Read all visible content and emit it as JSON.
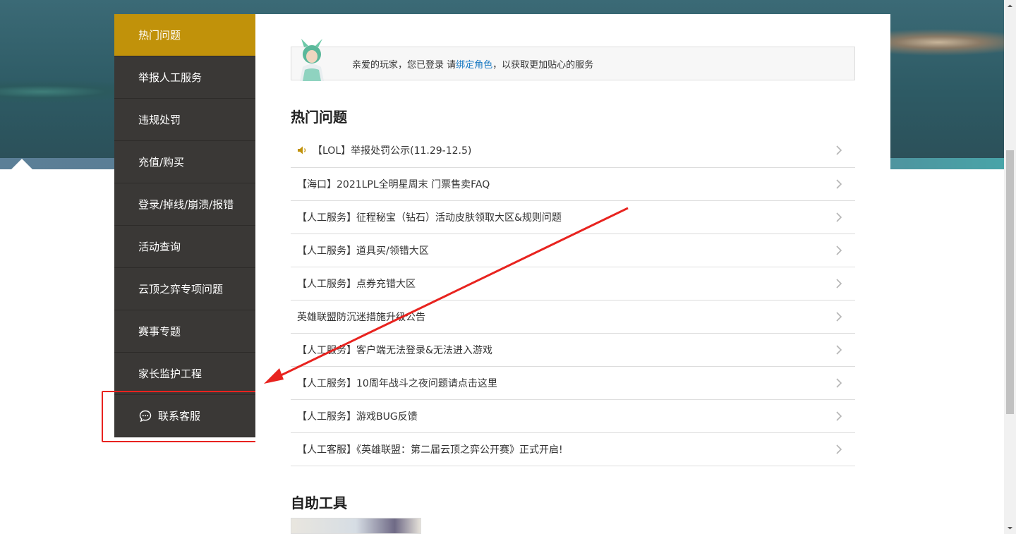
{
  "sidebar": {
    "items": [
      {
        "label": "热门问题",
        "active": true
      },
      {
        "label": "举报人工服务"
      },
      {
        "label": "违规处罚"
      },
      {
        "label": "充值/购买"
      },
      {
        "label": "登录/掉线/崩溃/报错"
      },
      {
        "label": "活动查询"
      },
      {
        "label": "云顶之弈专项问题"
      },
      {
        "label": "赛事专题"
      },
      {
        "label": "家长监护工程"
      }
    ],
    "contact": {
      "label": "联系客服",
      "icon": "chat-bubble-icon"
    }
  },
  "notice": {
    "prefix": "亲爱的玩家，您已登录 请",
    "link": "绑定角色",
    "suffix": "，以获取更加贴心的服务"
  },
  "hot": {
    "title": "热门问题",
    "items": [
      "【LOL】举报处罚公示(11.29-12.5)",
      "【海口】2021LPL全明星周末 门票售卖FAQ",
      "【人工服务】征程秘宝（钻石）活动皮肤领取大区&规则问题",
      "【人工服务】道具买/领错大区",
      "【人工服务】点券充错大区",
      "英雄联盟防沉迷措施升级公告",
      "【人工服务】客户端无法登录&无法进入游戏",
      "【人工服务】10周年战斗之夜问题请点击这里",
      "【人工服务】游戏BUG反馈",
      "【人工客服】《英雄联盟：第二届云顶之弈公开赛》正式开启!"
    ]
  },
  "tools": {
    "title": "自助工具"
  },
  "colors": {
    "active_tab": "#c1920a",
    "sidebar_bg": "#3a3836",
    "link": "#1577c2",
    "annotation": "#e8231f"
  }
}
